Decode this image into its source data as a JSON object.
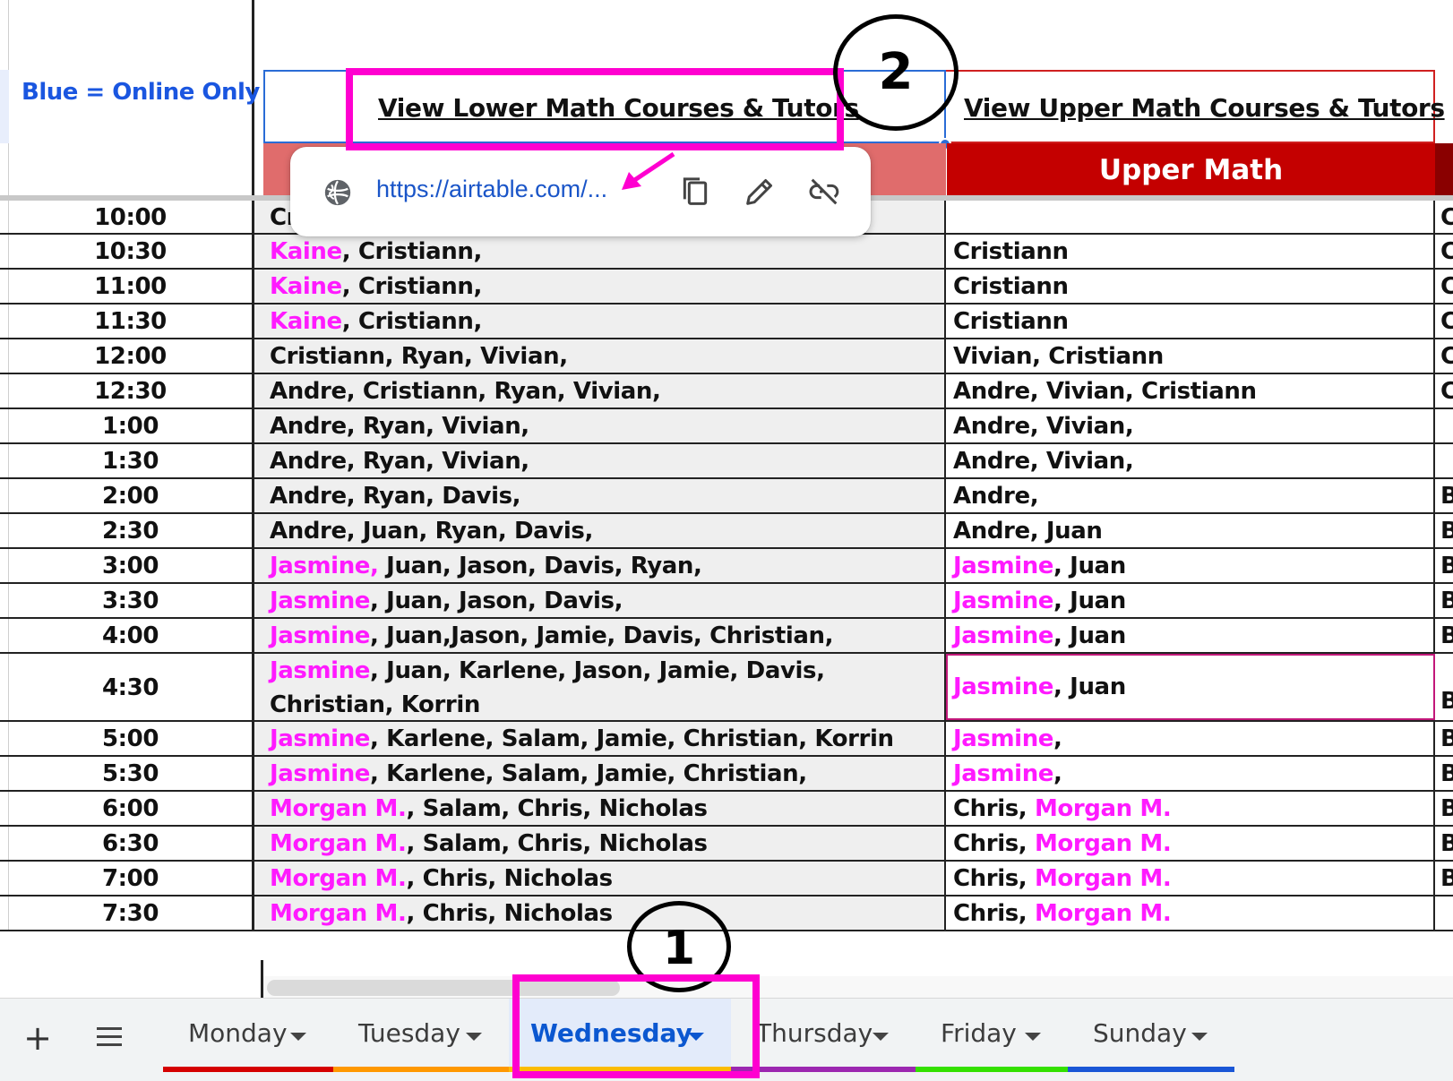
{
  "legend": {
    "text": "Blue = Online Only"
  },
  "links": {
    "lower": "View Lower Math Courses & Tutors",
    "upper": "View Upper Math Courses & Tutors"
  },
  "subheaders": {
    "upper": "Upper Math"
  },
  "link_popup": {
    "url": "https://airtable.com/..."
  },
  "annotations": {
    "step1": "1",
    "step2": "2"
  },
  "rows": [
    {
      "time": "10:00",
      "lower": [
        {
          "t": "Cr"
        }
      ],
      "upper": [],
      "next": "C"
    },
    {
      "time": "10:30",
      "lower": [
        {
          "t": "Kaine",
          "pink": true
        },
        {
          "t": ", Cristiann,"
        }
      ],
      "upper": [
        {
          "t": "Cristiann"
        }
      ],
      "next": "C"
    },
    {
      "time": "11:00",
      "lower": [
        {
          "t": "Kaine",
          "pink": true
        },
        {
          "t": ", Cristiann,"
        }
      ],
      "upper": [
        {
          "t": "Cristiann"
        }
      ],
      "next": "C"
    },
    {
      "time": "11:30",
      "lower": [
        {
          "t": "Kaine",
          "pink": true
        },
        {
          "t": ", Cristiann,"
        }
      ],
      "upper": [
        {
          "t": "Cristiann"
        }
      ],
      "next": "C"
    },
    {
      "time": "12:00",
      "lower": [
        {
          "t": "Cristiann, Ryan, Vivian,"
        }
      ],
      "upper": [
        {
          "t": "Vivian, Cristiann"
        }
      ],
      "next": "C"
    },
    {
      "time": "12:30",
      "lower": [
        {
          "t": "Andre, Cristiann, Ryan, Vivian,"
        }
      ],
      "upper": [
        {
          "t": "Andre, Vivian, Cristiann"
        }
      ],
      "next": "C"
    },
    {
      "time": "1:00",
      "lower": [
        {
          "t": "Andre, Ryan, Vivian,"
        }
      ],
      "upper": [
        {
          "t": "Andre, Vivian,"
        }
      ],
      "next": ""
    },
    {
      "time": "1:30",
      "lower": [
        {
          "t": "Andre, Ryan, Vivian,"
        }
      ],
      "upper": [
        {
          "t": "Andre, Vivian,"
        }
      ],
      "next": ""
    },
    {
      "time": "2:00",
      "lower": [
        {
          "t": "Andre, Ryan, Davis,"
        }
      ],
      "upper": [
        {
          "t": "Andre,"
        }
      ],
      "next": "B"
    },
    {
      "time": "2:30",
      "lower": [
        {
          "t": "Andre, Juan, Ryan, Davis,"
        }
      ],
      "upper": [
        {
          "t": "Andre, Juan"
        }
      ],
      "next": "B"
    },
    {
      "time": "3:00",
      "lower": [
        {
          "t": "Jasmine,",
          "pink": true
        },
        {
          "t": " Juan, Jason, Davis, Ryan,"
        }
      ],
      "upper": [
        {
          "t": "Jasmine",
          "pink": true
        },
        {
          "t": ", Juan"
        }
      ],
      "next": "B"
    },
    {
      "time": "3:30",
      "lower": [
        {
          "t": "Jasmine",
          "pink": true
        },
        {
          "t": ", Juan, Jason, Davis,"
        }
      ],
      "upper": [
        {
          "t": "Jasmine",
          "pink": true
        },
        {
          "t": ", Juan"
        }
      ],
      "next": "B"
    },
    {
      "time": "4:00",
      "lower": [
        {
          "t": "Jasmine",
          "pink": true
        },
        {
          "t": ", Juan,Jason, Jamie, Davis, Christian,"
        }
      ],
      "upper": [
        {
          "t": "Jasmine",
          "pink": true
        },
        {
          "t": ", Juan"
        }
      ],
      "next": "B"
    },
    {
      "time": "4:30",
      "lower": [
        {
          "t": "Jasmine",
          "pink": true
        },
        {
          "t": ", Juan, Karlene, Jason, Jamie, Davis, Christian, Korrin"
        }
      ],
      "upper": [
        {
          "t": "Jasmine",
          "pink": true
        },
        {
          "t": ", Juan"
        }
      ],
      "next": "B"
    },
    {
      "time": "5:00",
      "lower": [
        {
          "t": "Jasmine",
          "pink": true
        },
        {
          "t": ", Karlene, Salam, Jamie, Christian, Korrin"
        }
      ],
      "upper": [
        {
          "t": "Jasmine",
          "pink": true
        },
        {
          "t": ","
        }
      ],
      "next": "B"
    },
    {
      "time": "5:30",
      "lower": [
        {
          "t": "Jasmine",
          "pink": true
        },
        {
          "t": ", Karlene, Salam, Jamie, Christian,"
        }
      ],
      "upper": [
        {
          "t": "Jasmine",
          "pink": true
        },
        {
          "t": ","
        }
      ],
      "next": "B"
    },
    {
      "time": "6:00",
      "lower": [
        {
          "t": "Morgan M.",
          "pink": true
        },
        {
          "t": ", Salam, Chris, Nicholas"
        }
      ],
      "upper": [
        {
          "t": "Chris, "
        },
        {
          "t": "Morgan M.",
          "pink": true
        }
      ],
      "next": "B"
    },
    {
      "time": "6:30",
      "lower": [
        {
          "t": "Morgan M.",
          "pink": true
        },
        {
          "t": ", Salam, Chris, Nicholas"
        }
      ],
      "upper": [
        {
          "t": "Chris, "
        },
        {
          "t": "Morgan M.",
          "pink": true
        }
      ],
      "next": "B"
    },
    {
      "time": "7:00",
      "lower": [
        {
          "t": "Morgan M.",
          "pink": true
        },
        {
          "t": ", Chris, Nicholas"
        }
      ],
      "upper": [
        {
          "t": "Chris, "
        },
        {
          "t": "Morgan M.",
          "pink": true
        }
      ],
      "next": "B"
    },
    {
      "time": "7:30",
      "lower": [
        {
          "t": "Morgan M.",
          "pink": true
        },
        {
          "t": ", Chris, Nicholas"
        }
      ],
      "upper": [
        {
          "t": "Chris, "
        },
        {
          "t": "Morgan M.",
          "pink": true
        }
      ],
      "next": ""
    }
  ],
  "tabs": [
    {
      "label": "Monday",
      "color": "#d50000",
      "active": false
    },
    {
      "label": "Tuesday",
      "color": "#ff9800",
      "active": false
    },
    {
      "label": "Wednesday",
      "color": "#fbbc04",
      "active": true
    },
    {
      "label": "Thursday",
      "color": "#9c27b0",
      "active": false
    },
    {
      "label": "Friday",
      "color": "#34e000",
      "active": false
    },
    {
      "label": "Sunday",
      "color": "#1a56d6",
      "active": false
    }
  ],
  "icons": {
    "add_sheet": "plus-icon",
    "all_sheets": "hamburger-menu-icon",
    "globe": "globe-icon",
    "copy": "copy-icon",
    "edit": "pencil-icon",
    "unlink": "unlink-icon"
  }
}
